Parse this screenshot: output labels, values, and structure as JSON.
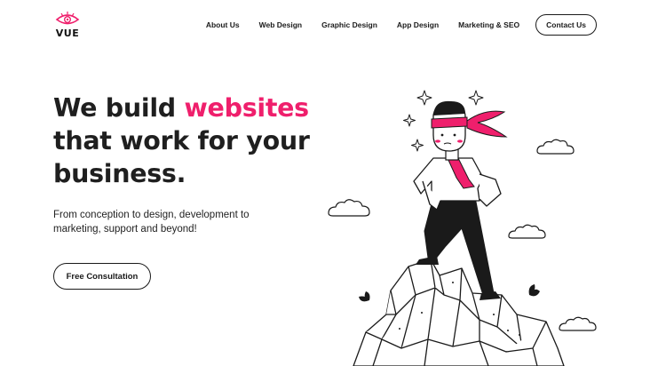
{
  "brand": {
    "name": "VUE",
    "accent": "#ef1f6c"
  },
  "nav": {
    "items": [
      "About Us",
      "Web Design",
      "Graphic Design",
      "App Design",
      "Marketing & SEO"
    ],
    "cta_label": "Contact Us"
  },
  "hero": {
    "line1_prefix": "We build ",
    "line1_accent": "websites",
    "line2": "that work for your",
    "line3": "business.",
    "subtitle": "From conception to design, development to marketing, support and beyond!",
    "cta_label": "Free Consultation"
  },
  "illustration": {
    "icon": "man-on-mountain-illustration"
  }
}
